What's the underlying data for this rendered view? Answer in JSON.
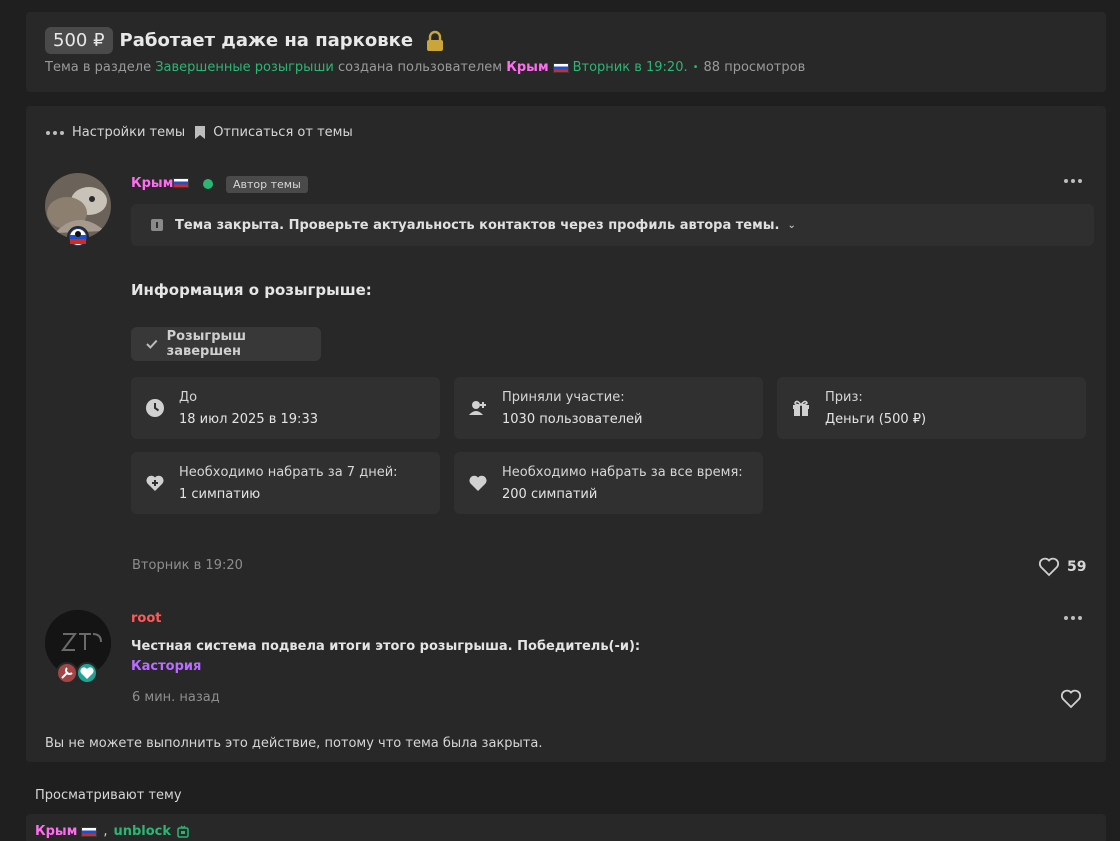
{
  "header": {
    "prefix": "500 ₽",
    "title": "Работает даже на парковке",
    "meta_prefix": "Тема в разделе",
    "section": "Завершенные розыгрыши",
    "created_by": "создана пользователем",
    "author": "Крым",
    "date": "Вторник в 19:20.",
    "views": "88 просмотров"
  },
  "toolbar": {
    "settings_label": "Настройки темы",
    "unsubscribe_label": "Отписаться от темы"
  },
  "post1": {
    "username": "Крым",
    "author_badge": "Автор темы",
    "notice": "Тема закрыта. Проверьте актуальность контактов через профиль автора темы.",
    "info_title": "Информация о розыгрыше:",
    "status": "Розыгрыш завершен",
    "cards": [
      {
        "label": "До",
        "value": "18 июл 2025 в 19:33"
      },
      {
        "label": "Приняли участие:",
        "value": "1030 пользователей"
      },
      {
        "label": "Приз:",
        "value": "Деньги (500 ₽)"
      },
      {
        "label": "Необходимо набрать за 7 дней:",
        "value": "1 симпатию"
      },
      {
        "label": "Необходимо набрать за все время:",
        "value": "200 симпатий"
      }
    ],
    "date": "Вторник в 19:20",
    "likes": "59"
  },
  "post2": {
    "username": "root",
    "text": "Честная система подвела итоги этого розыгрыша. Победитель(-и):",
    "winner": "Кастория",
    "date": "6 мин. назад"
  },
  "closed_message": "Вы не можете выполнить это действие, потому что тема была закрыта.",
  "viewers": {
    "title": "Просматривают тему",
    "users": [
      "Крым",
      "unblock"
    ],
    "separator": ","
  },
  "colors": {
    "green": "#2bb673",
    "pink": "#ff6cf0",
    "purple": "#b96cff",
    "red": "#ff5a5a"
  }
}
